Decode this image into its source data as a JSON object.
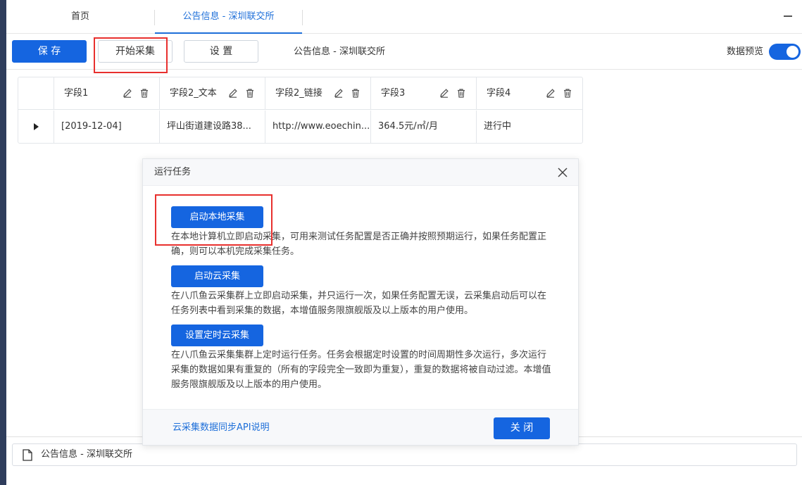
{
  "tabs": {
    "home_label": "首页",
    "active_label": "公告信息 - 深圳联交所"
  },
  "toolbar": {
    "save_label": "保 存",
    "start_label": "开始采集",
    "settings_label": "设 置",
    "task_title": "公告信息 - 深圳联交所",
    "preview_label": "数据预览",
    "preview_enabled": true
  },
  "grid": {
    "columns": [
      "字段1",
      "字段2_文本",
      "字段2_链接",
      "字段3",
      "字段4"
    ],
    "rows": [
      [
        "[2019-12-04]",
        "坪山街道建设路38...",
        "http://www.eoechin...",
        "364.5元/㎡/月",
        "进行中"
      ]
    ]
  },
  "modal": {
    "title": "运行任务",
    "options": [
      {
        "button": "启动本地采集",
        "description": "在本地计算机立即启动采集，可用来测试任务配置是否正确并按照预期运行，如果任务配置正确，则可以本机完成采集任务。"
      },
      {
        "button": "启动云采集",
        "description": "在八爪鱼云采集群上立即启动采集，并只运行一次，如果任务配置无误，云采集启动后可以在任务列表中看到采集的数据，本增值服务限旗舰版及以上版本的用户使用。"
      },
      {
        "button": "设置定时云采集",
        "description": "在八爪鱼云采集集群上定时运行任务。任务会根据定时设置的时间周期性多次运行，多次运行采集的数据如果有重复的（所有的字段完全一致即为重复），重复的数据将被自动过滤。本增值服务限旗舰版及以上版本的用户使用。"
      }
    ],
    "api_link": "云采集数据同步API说明",
    "close_label": "关 闭"
  },
  "bottom_bar": {
    "label": "公告信息 - 深圳联交所"
  },
  "colors": {
    "primary": "#1565e0",
    "annotation": "#e8302e",
    "sidebar": "#2f3d5c"
  }
}
